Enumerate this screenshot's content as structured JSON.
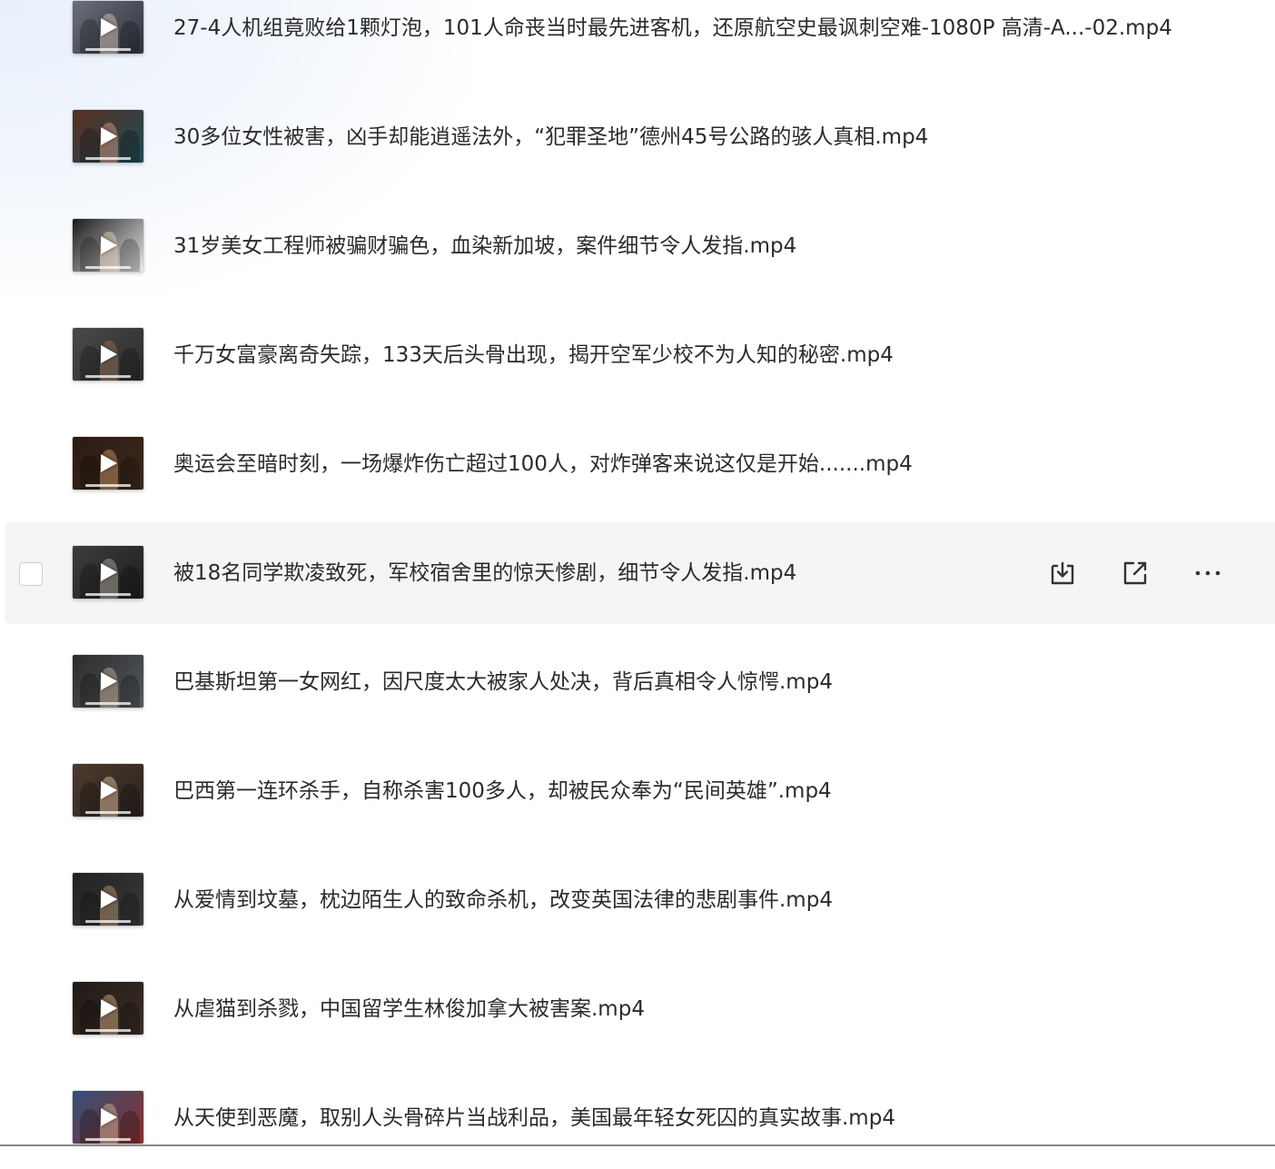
{
  "files": [
    {
      "name": "27-4人机组竟败给1颗灯泡，101人命丧当时最先进客机，还原航空史最讽刺空难-1080P 高清-A...-02.mp4",
      "thumb_colors": [
        "#6a6f79",
        "#c9b7a6",
        "#2f3440"
      ]
    },
    {
      "name": "30多位女性被害，凶手却能逍遥法外，“犯罪圣地”德州45号公路的骇人真相.mp4",
      "thumb_colors": [
        "#5a2f22",
        "#c38f78",
        "#1e4b57"
      ]
    },
    {
      "name": "31岁美女工程师被骗财骗色，血染新加坡，案件细节令人发指.mp4",
      "thumb_colors": [
        "#1b1b1b",
        "#d9c6b0",
        "#e8e8e8"
      ]
    },
    {
      "name": "千万女富豪离奇失踪，133天后头骨出现，揭开空军少校不为人知的秘密.mp4",
      "thumb_colors": [
        "#4a4a4a",
        "#8a6a55",
        "#2c2c2c"
      ]
    },
    {
      "name": "奥运会至暗时刻，一场爆炸伤亡超过100人，对炸弹客来说这仅是开始.......mp4",
      "thumb_colors": [
        "#2a1a10",
        "#b58a5c",
        "#3c2a1e"
      ]
    },
    {
      "name": "被18名同学欺凌致死，军校宿舍里的惊天惨剧，细节令人发指.mp4",
      "thumb_colors": [
        "#3d3d3d",
        "#a69a90",
        "#1e1e1e"
      ]
    },
    {
      "name": "巴基斯坦第一女网红，因尺度太大被家人处决，背后真相令人惊愕.mp4",
      "thumb_colors": [
        "#2b2b2b",
        "#b7a08a",
        "#555a60"
      ]
    },
    {
      "name": "巴西第一连环杀手，自称杀害100多人，却被民众奉为“民间英雄”.mp4",
      "thumb_colors": [
        "#4c3a2c",
        "#d0b08e",
        "#2b2420"
      ]
    },
    {
      "name": "从爱情到坟墓，枕边陌生人的致命杀机，改变英国法律的悲剧事件.mp4",
      "thumb_colors": [
        "#222222",
        "#a7876a",
        "#3a3a3a"
      ]
    },
    {
      "name": "从虐猫到杀戮，中国留学生林俊加拿大被害案.mp4",
      "thumb_colors": [
        "#201a16",
        "#c09a7a",
        "#3b2e26"
      ]
    },
    {
      "name": "从天使到恶魔，取别人头骨碎片当战利品，美国最年轻女死囚的真实故事.mp4",
      "thumb_colors": [
        "#33507a",
        "#c7a58c",
        "#8a2f2a"
      ]
    }
  ],
  "hovered_index": 5,
  "colors": {
    "text": "#2b2b2b",
    "hover_bg": "#f5f5f5",
    "icon": "#333333"
  },
  "icons": {
    "play": "play-icon",
    "download": "download-icon",
    "share": "share-icon",
    "more": "more-icon"
  }
}
